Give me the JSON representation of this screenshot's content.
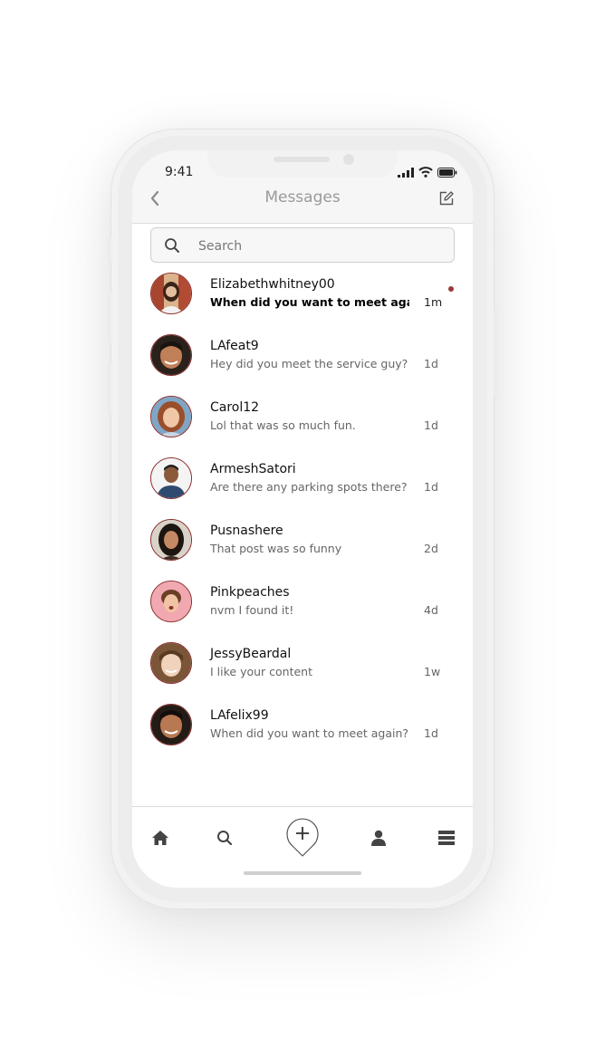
{
  "status_bar": {
    "time": "9:41"
  },
  "header": {
    "title": "Messages"
  },
  "search": {
    "placeholder": "Search"
  },
  "conversations": [
    {
      "name": "Elizabethwhitney00",
      "preview": "When did you want to meet again?...",
      "time": "1m",
      "unread": true
    },
    {
      "name": "LAfeat9",
      "preview": "Hey did you meet the service guy?",
      "time": "1d",
      "unread": false
    },
    {
      "name": "Carol12",
      "preview": "Lol that was so much fun.",
      "time": "1d",
      "unread": false
    },
    {
      "name": "ArmeshSatori",
      "preview": "Are there any parking spots there?",
      "time": "1d",
      "unread": false
    },
    {
      "name": "Pusnashere",
      "preview": "That post was so funny",
      "time": "2d",
      "unread": false
    },
    {
      "name": "Pinkpeaches",
      "preview": "nvm I found it!",
      "time": "4d",
      "unread": false
    },
    {
      "name": "JessyBeardal",
      "preview": "I like your content",
      "time": "1w",
      "unread": false
    },
    {
      "name": "LAfelix99",
      "preview": "When did you want to meet again?...",
      "time": "1d",
      "unread": false
    }
  ],
  "tab_bar": {
    "items": [
      {
        "icon": "home-icon"
      },
      {
        "icon": "search-icon"
      },
      {
        "icon": "plus-icon"
      },
      {
        "icon": "profile-icon"
      },
      {
        "icon": "menu-icon"
      }
    ]
  },
  "colors": {
    "accent": "#8b2c2c",
    "unread_dot": "#9b3a3a",
    "title_gray": "#9a9a9a"
  }
}
